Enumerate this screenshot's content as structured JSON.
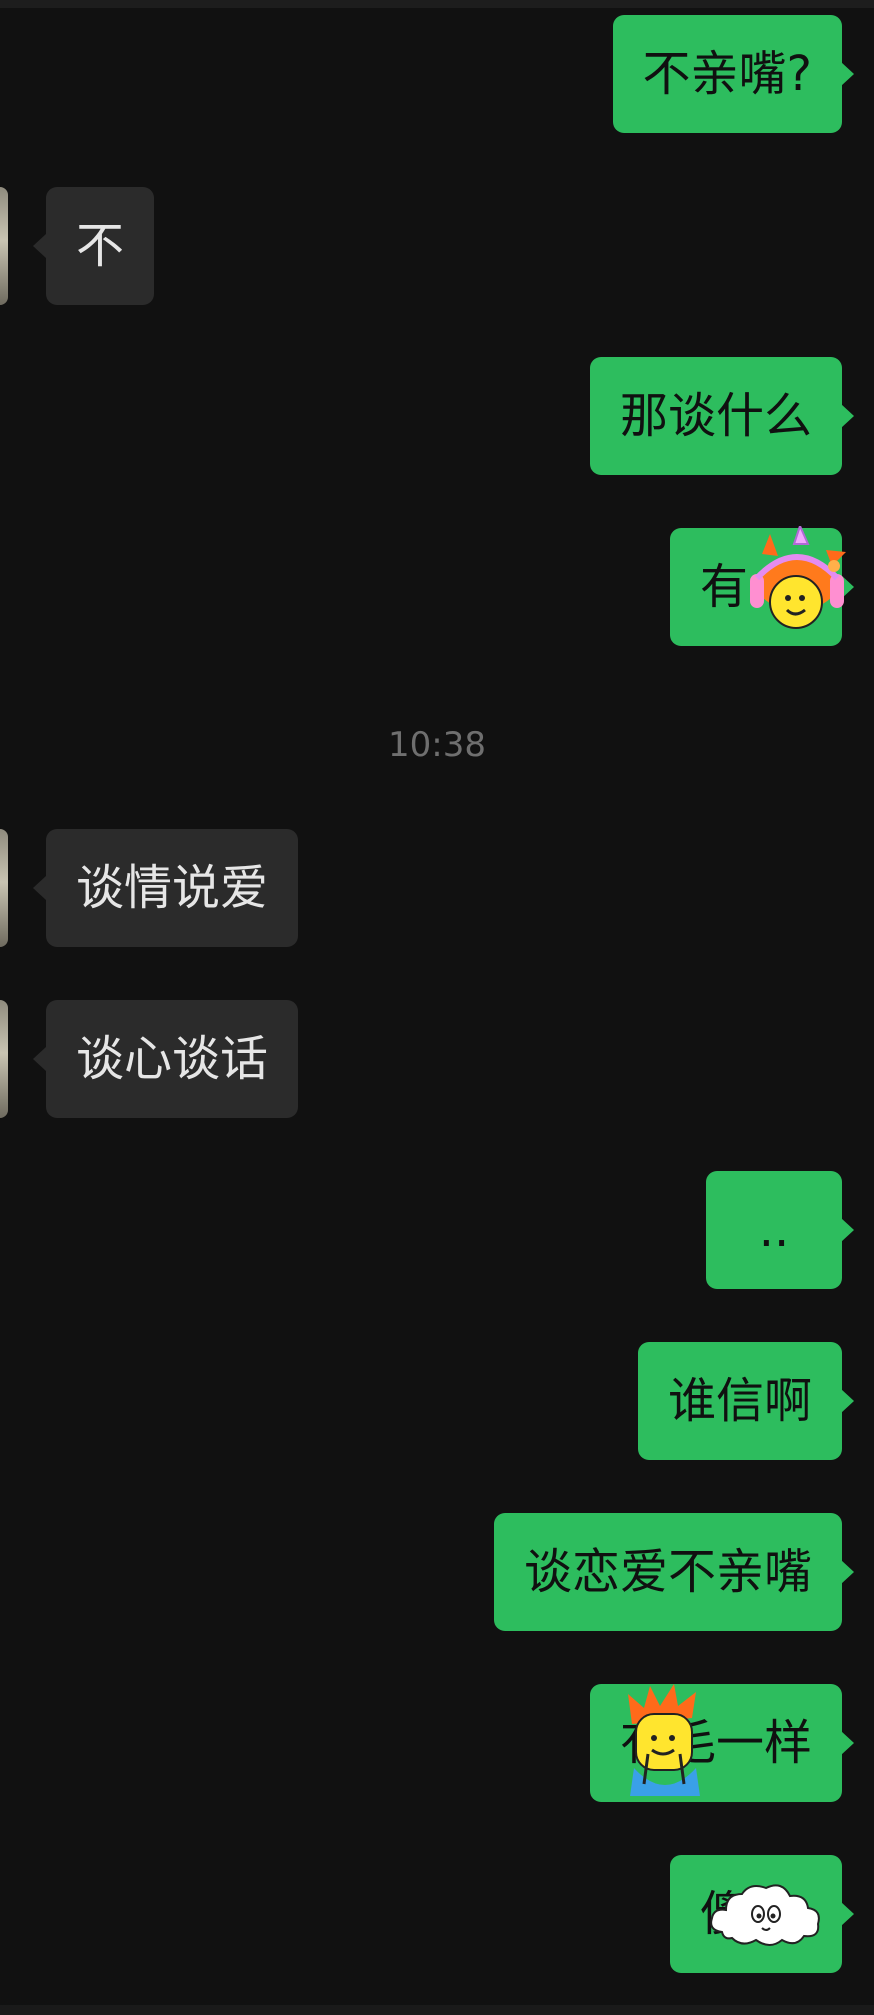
{
  "messages": [
    {
      "side": "out",
      "text": "不亲嘴?"
    },
    {
      "side": "in",
      "text": "不"
    },
    {
      "side": "out",
      "text": "那谈什么"
    },
    {
      "side": "out",
      "text": "有",
      "sticker": "girl-headphones-sticker"
    },
    {
      "side": "in",
      "text": "谈情说爱"
    },
    {
      "side": "in",
      "text": "谈心谈话"
    },
    {
      "side": "out",
      "text": ".."
    },
    {
      "side": "out",
      "text": "谁信啊"
    },
    {
      "side": "out",
      "text": "谈恋爱不亲嘴"
    },
    {
      "side": "out",
      "text": "有毛一样",
      "sticker": "boy-orange-hair-sticker"
    },
    {
      "side": "out",
      "text": "傻",
      "sticker": "cloud-sticker"
    }
  ],
  "timestamp": "10:38",
  "colors": {
    "background": "#111111",
    "outgoing_bubble": "#2dbd5e",
    "incoming_bubble": "#2b2b2b",
    "timestamp_text": "#6f6f6f"
  }
}
